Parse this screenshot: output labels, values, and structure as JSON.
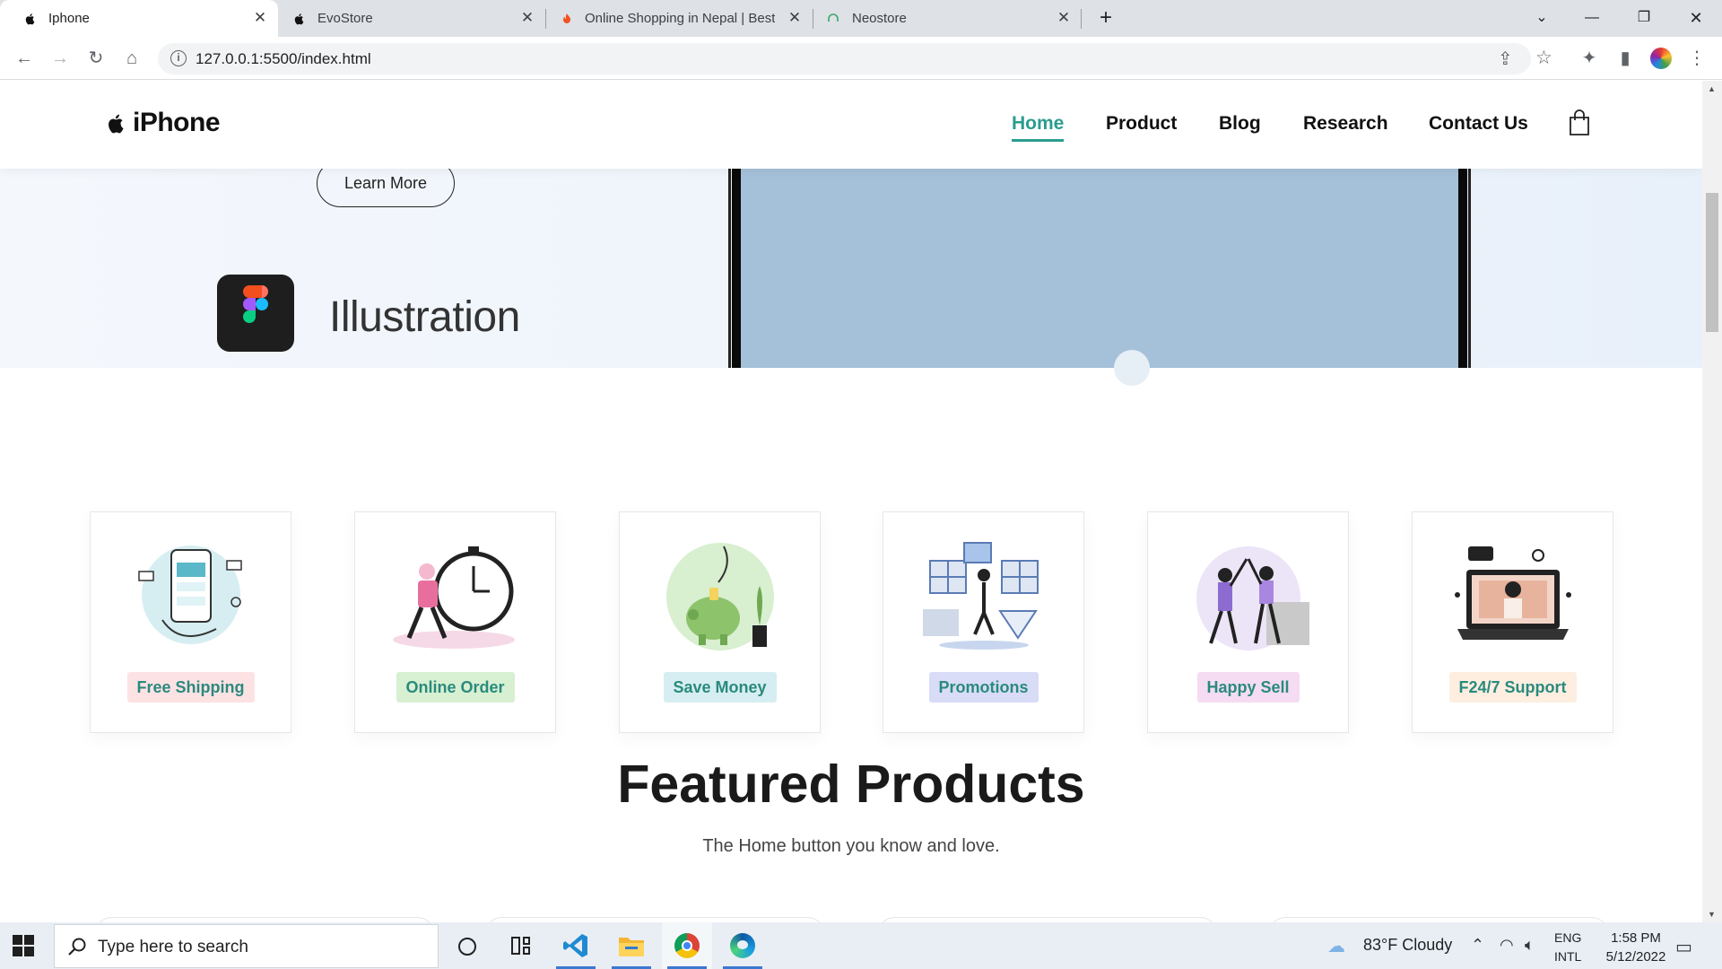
{
  "browser": {
    "tabs": [
      {
        "title": "Iphone",
        "active": true
      },
      {
        "title": "EvoStore",
        "active": false
      },
      {
        "title": "Online Shopping in Nepal | Best",
        "active": false
      },
      {
        "title": "Neostore",
        "active": false
      }
    ],
    "url": "127.0.0.1:5500/index.html"
  },
  "site": {
    "logo_text": "iPhone",
    "nav": {
      "home": "Home",
      "product": "Product",
      "blog": "Blog",
      "research": "Research",
      "contact": "Contact Us"
    },
    "hero": {
      "learn_more": "Learn More",
      "illustration_label": "Illustration"
    },
    "features": [
      {
        "label": "Free Shipping",
        "badge_color": "#fde2e4"
      },
      {
        "label": "Online Order",
        "badge_color": "#d8f0d2"
      },
      {
        "label": "Save Money",
        "badge_color": "#d6eef2"
      },
      {
        "label": "Promotions",
        "badge_color": "#d9dcf7"
      },
      {
        "label": "Happy Sell",
        "badge_color": "#f5dcf3"
      },
      {
        "label": "F24/7 Support",
        "badge_color": "#fdeee0"
      }
    ],
    "featured": {
      "title": "Featured Products",
      "subtitle": "The Home button you know and love."
    },
    "accent_color": "#2a9d8f"
  },
  "taskbar": {
    "search_placeholder": "Type here to search",
    "weather": "83°F  Cloudy",
    "lang_top": "ENG",
    "lang_bottom": "INTL",
    "time": "1:58 PM",
    "date": "5/12/2022"
  }
}
